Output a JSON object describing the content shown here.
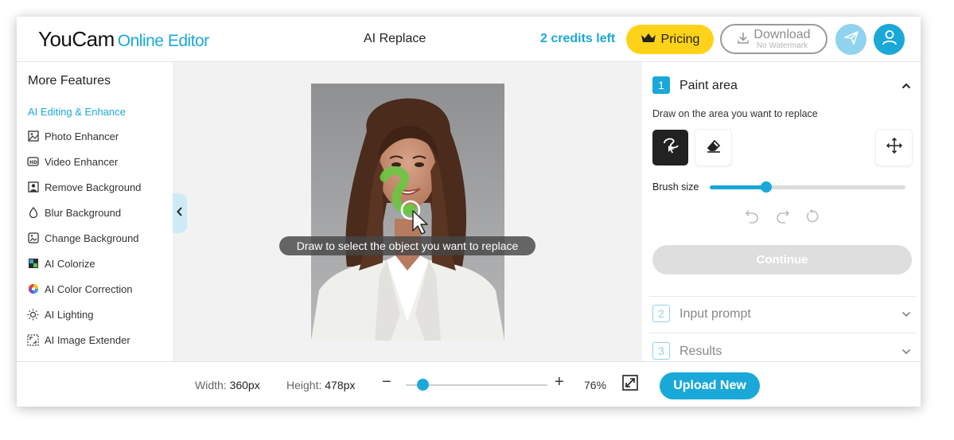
{
  "header": {
    "logo_brand": "YouCam",
    "logo_sub": "Online Editor",
    "title": "AI Replace",
    "credits": "2 credits left",
    "pricing_label": "Pricing",
    "download_label": "Download",
    "download_sub": "No Watermark"
  },
  "sidebar": {
    "title": "More Features",
    "section": "AI Editing & Enhance",
    "items": [
      {
        "label": "Photo Enhancer",
        "icon": "photo-enhancer-icon"
      },
      {
        "label": "Video Enhancer",
        "icon": "hd-video-icon"
      },
      {
        "label": "Remove Background",
        "icon": "remove-background-icon"
      },
      {
        "label": "Blur Background",
        "icon": "droplet-icon"
      },
      {
        "label": "Change Background",
        "icon": "image-swap-icon"
      },
      {
        "label": "AI Colorize",
        "icon": "colorize-icon"
      },
      {
        "label": "AI Color Correction",
        "icon": "color-wheel-icon"
      },
      {
        "label": "AI Lighting",
        "icon": "sun-icon"
      },
      {
        "label": "AI Image Extender",
        "icon": "expand-frame-icon"
      }
    ]
  },
  "canvas": {
    "tip": "Draw to select the object you want to replace"
  },
  "panel": {
    "step1": {
      "num": "1",
      "title": "Paint area"
    },
    "description": "Draw on the area you want to replace",
    "brush_label": "Brush size",
    "brush_value": 0.29,
    "continue_label": "Continue",
    "step2": {
      "num": "2",
      "title": "Input prompt"
    },
    "step3": {
      "num": "3",
      "title": "Results"
    }
  },
  "footer": {
    "width_label": "Width:",
    "width_value": "360px",
    "height_label": "Height:",
    "height_value": "478px",
    "zoom_minus": "−",
    "zoom_plus": "+",
    "zoom_value": "76%",
    "zoom_level": 0.12,
    "upload_label": "Upload New"
  },
  "colors": {
    "accent": "#1aa8d9",
    "pricing": "#ffd21a",
    "paint_stroke": "#6cc644"
  }
}
